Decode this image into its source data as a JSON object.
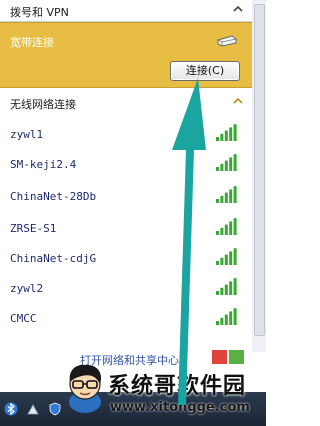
{
  "sections": {
    "vpn": {
      "label": "拨号和 VPN"
    },
    "broadband": {
      "name": "宽带连接",
      "connect_label": "连接(C)"
    },
    "wifi": {
      "label": "无线网络连接"
    }
  },
  "networks": [
    {
      "ssid": "zywl1",
      "signal_bars": 5
    },
    {
      "ssid": "SM-keji2.4",
      "signal_bars": 5
    },
    {
      "ssid": "ChinaNet-28Db",
      "signal_bars": 5
    },
    {
      "ssid": "ZRSE-S1",
      "signal_bars": 5
    },
    {
      "ssid": "ChinaNet-cdjG",
      "signal_bars": 5
    },
    {
      "ssid": "zywl2",
      "signal_bars": 5
    },
    {
      "ssid": "CMCC",
      "signal_bars": 5
    }
  ],
  "footer": {
    "open_network_center": "打开网络和共享中心"
  },
  "watermark": {
    "title": "系统哥软件园",
    "url": "www.xitongge.com"
  },
  "colors": {
    "highlight": "#e8bd43",
    "signal": "#3aa635",
    "arrow": "#1aa5a0",
    "ssid_text": "#1f2a6e"
  },
  "icons": {
    "chevron": "chevron-up-icon",
    "modem": "modem-icon",
    "signal": "wifi-signal-icon"
  }
}
